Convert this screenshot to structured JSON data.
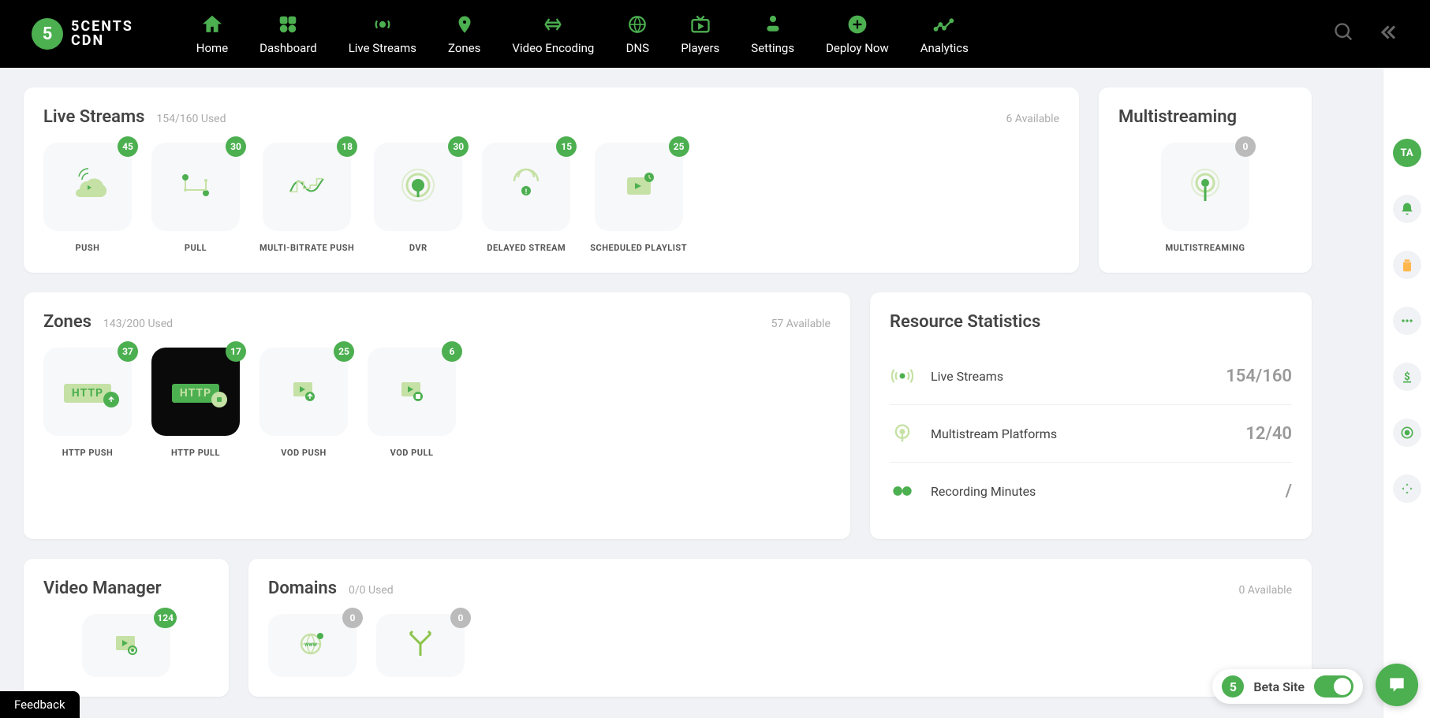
{
  "brand": {
    "name1": "5CENTS",
    "name2": "CDN",
    "mark": "5"
  },
  "nav": [
    {
      "label": "Home"
    },
    {
      "label": "Dashboard"
    },
    {
      "label": "Live Streams"
    },
    {
      "label": "Zones"
    },
    {
      "label": "Video Encoding"
    },
    {
      "label": "DNS"
    },
    {
      "label": "Players"
    },
    {
      "label": "Settings"
    },
    {
      "label": "Deploy Now"
    },
    {
      "label": "Analytics"
    }
  ],
  "liveStreams": {
    "title": "Live Streams",
    "used": "154/160 Used",
    "available": "6 Available",
    "tiles": [
      {
        "label": "PUSH",
        "count": "45"
      },
      {
        "label": "PULL",
        "count": "30"
      },
      {
        "label": "MULTI-BITRATE PUSH",
        "count": "18"
      },
      {
        "label": "DVR",
        "count": "30"
      },
      {
        "label": "DELAYED STREAM",
        "count": "15"
      },
      {
        "label": "SCHEDULED PLAYLIST",
        "count": "25"
      }
    ]
  },
  "multistreaming": {
    "title": "Multistreaming",
    "tile": {
      "label": "MULTISTREAMING",
      "count": "0"
    }
  },
  "zones": {
    "title": "Zones",
    "used": "143/200 Used",
    "available": "57 Available",
    "tiles": [
      {
        "label": "HTTP PUSH",
        "count": "37",
        "text": "HTTP"
      },
      {
        "label": "HTTP PULL",
        "count": "17",
        "text": "HTTP"
      },
      {
        "label": "VOD PUSH",
        "count": "25"
      },
      {
        "label": "VOD PULL",
        "count": "6"
      }
    ]
  },
  "videoManager": {
    "title": "Video Manager",
    "tile": {
      "count": "124"
    }
  },
  "domains": {
    "title": "Domains",
    "used": "0/0 Used",
    "available": "0 Available",
    "tiles": [
      {
        "count": "0"
      },
      {
        "count": "0"
      }
    ]
  },
  "stats": {
    "title": "Resource Statistics",
    "rows": [
      {
        "label": "Live Streams",
        "value": "154/160"
      },
      {
        "label": "Multistream Platforms",
        "value": "12/40"
      },
      {
        "label": "Recording Minutes",
        "value": "/"
      }
    ]
  },
  "avatar": "TA",
  "feedback": "Feedback",
  "beta": {
    "label": "Beta Site"
  }
}
